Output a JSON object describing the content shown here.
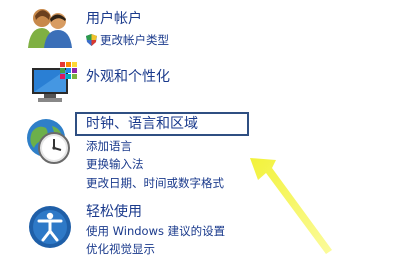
{
  "categories": [
    {
      "title": "用户帐户",
      "links": [
        "更改帐户类型"
      ],
      "link_shield": true,
      "icon": "users-icon"
    },
    {
      "title": "外观和个性化",
      "links": [],
      "icon": "monitor-palette-icon"
    },
    {
      "title": "时钟、语言和区域",
      "links": [
        "添加语言",
        "更换输入法",
        "更改日期、时间或数字格式"
      ],
      "icon": "clock-globe-icon",
      "highlighted": true
    },
    {
      "title": "轻松使用",
      "links": [
        "使用 Windows 建议的设置",
        "优化视觉显示"
      ],
      "icon": "ease-of-access-icon"
    }
  ],
  "colors": {
    "link": "#1a3a8c",
    "highlight_box": "#2f4f82",
    "arrow": "#f2f23a"
  }
}
